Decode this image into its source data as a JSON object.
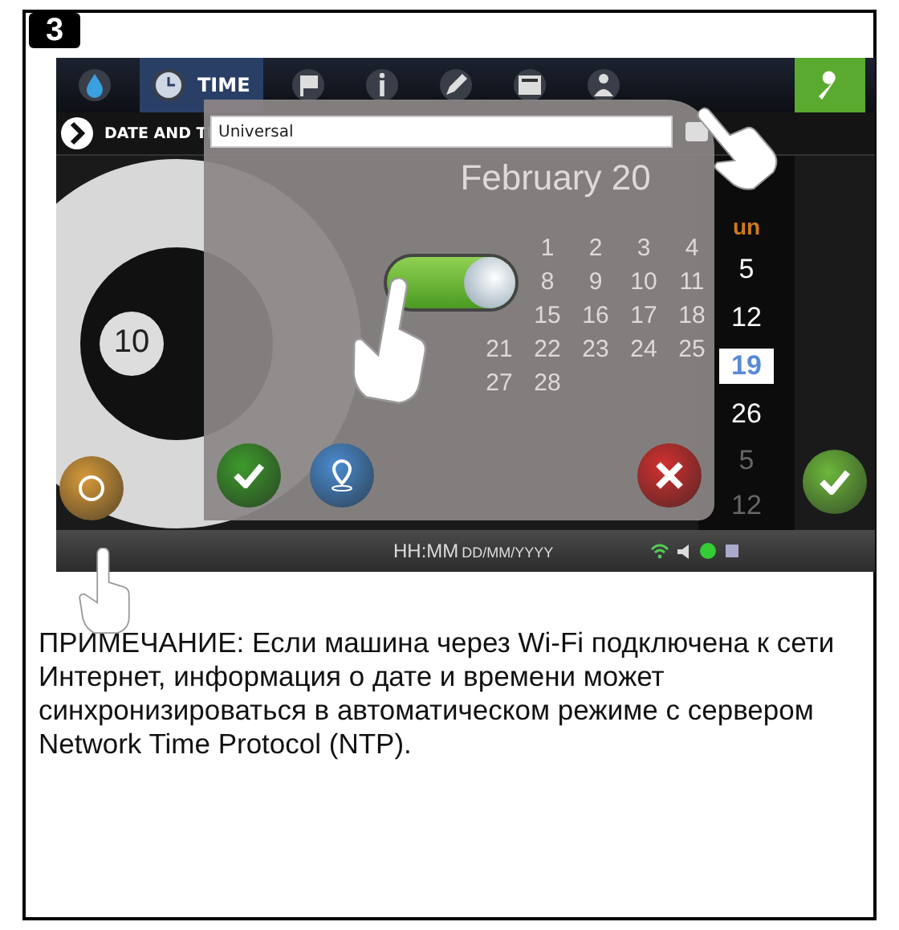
{
  "step": "3",
  "toolbar": {
    "tabs": [
      {
        "kind": "drop",
        "selected": false
      },
      {
        "kind": "clock",
        "label": "TIME",
        "selected": true
      },
      {
        "kind": "flag",
        "selected": false
      },
      {
        "kind": "info",
        "selected": false
      },
      {
        "kind": "pencil",
        "selected": false
      },
      {
        "kind": "panel",
        "selected": false
      },
      {
        "kind": "person",
        "selected": false
      }
    ]
  },
  "section_title": "DATE AND TI",
  "dial": {
    "value": "10"
  },
  "calendar": {
    "day_header": "un",
    "days": [
      {
        "label": "5",
        "selected": false
      },
      {
        "label": "12",
        "selected": false
      },
      {
        "label": "19",
        "selected": true
      },
      {
        "label": "26",
        "selected": false
      }
    ],
    "next_days": [
      "5",
      "12"
    ]
  },
  "dialog": {
    "timezone": {
      "value": "Universal"
    },
    "month": "February 20",
    "faded_rows": [
      [
        "",
        "1",
        "2",
        "3",
        "4"
      ],
      [
        "",
        "8",
        "9",
        "10",
        "11"
      ],
      [
        "",
        "15",
        "16",
        "17",
        "18"
      ],
      [
        "21",
        "22",
        "23",
        "24",
        "25"
      ],
      [
        "27",
        "28",
        "",
        "",
        ""
      ]
    ],
    "auto_sync": {
      "on": true
    }
  },
  "status_bar": {
    "time_format": "HH:MM",
    "date_format": "DD/MM/YYYY"
  },
  "note": "ПРИМЕЧАНИЕ: Если машина через Wi-Fi подключена к сети Интернет, информация о дате и времени может синхронизироваться в автоматическом режиме с сервером Network Time Protocol (NTP)."
}
